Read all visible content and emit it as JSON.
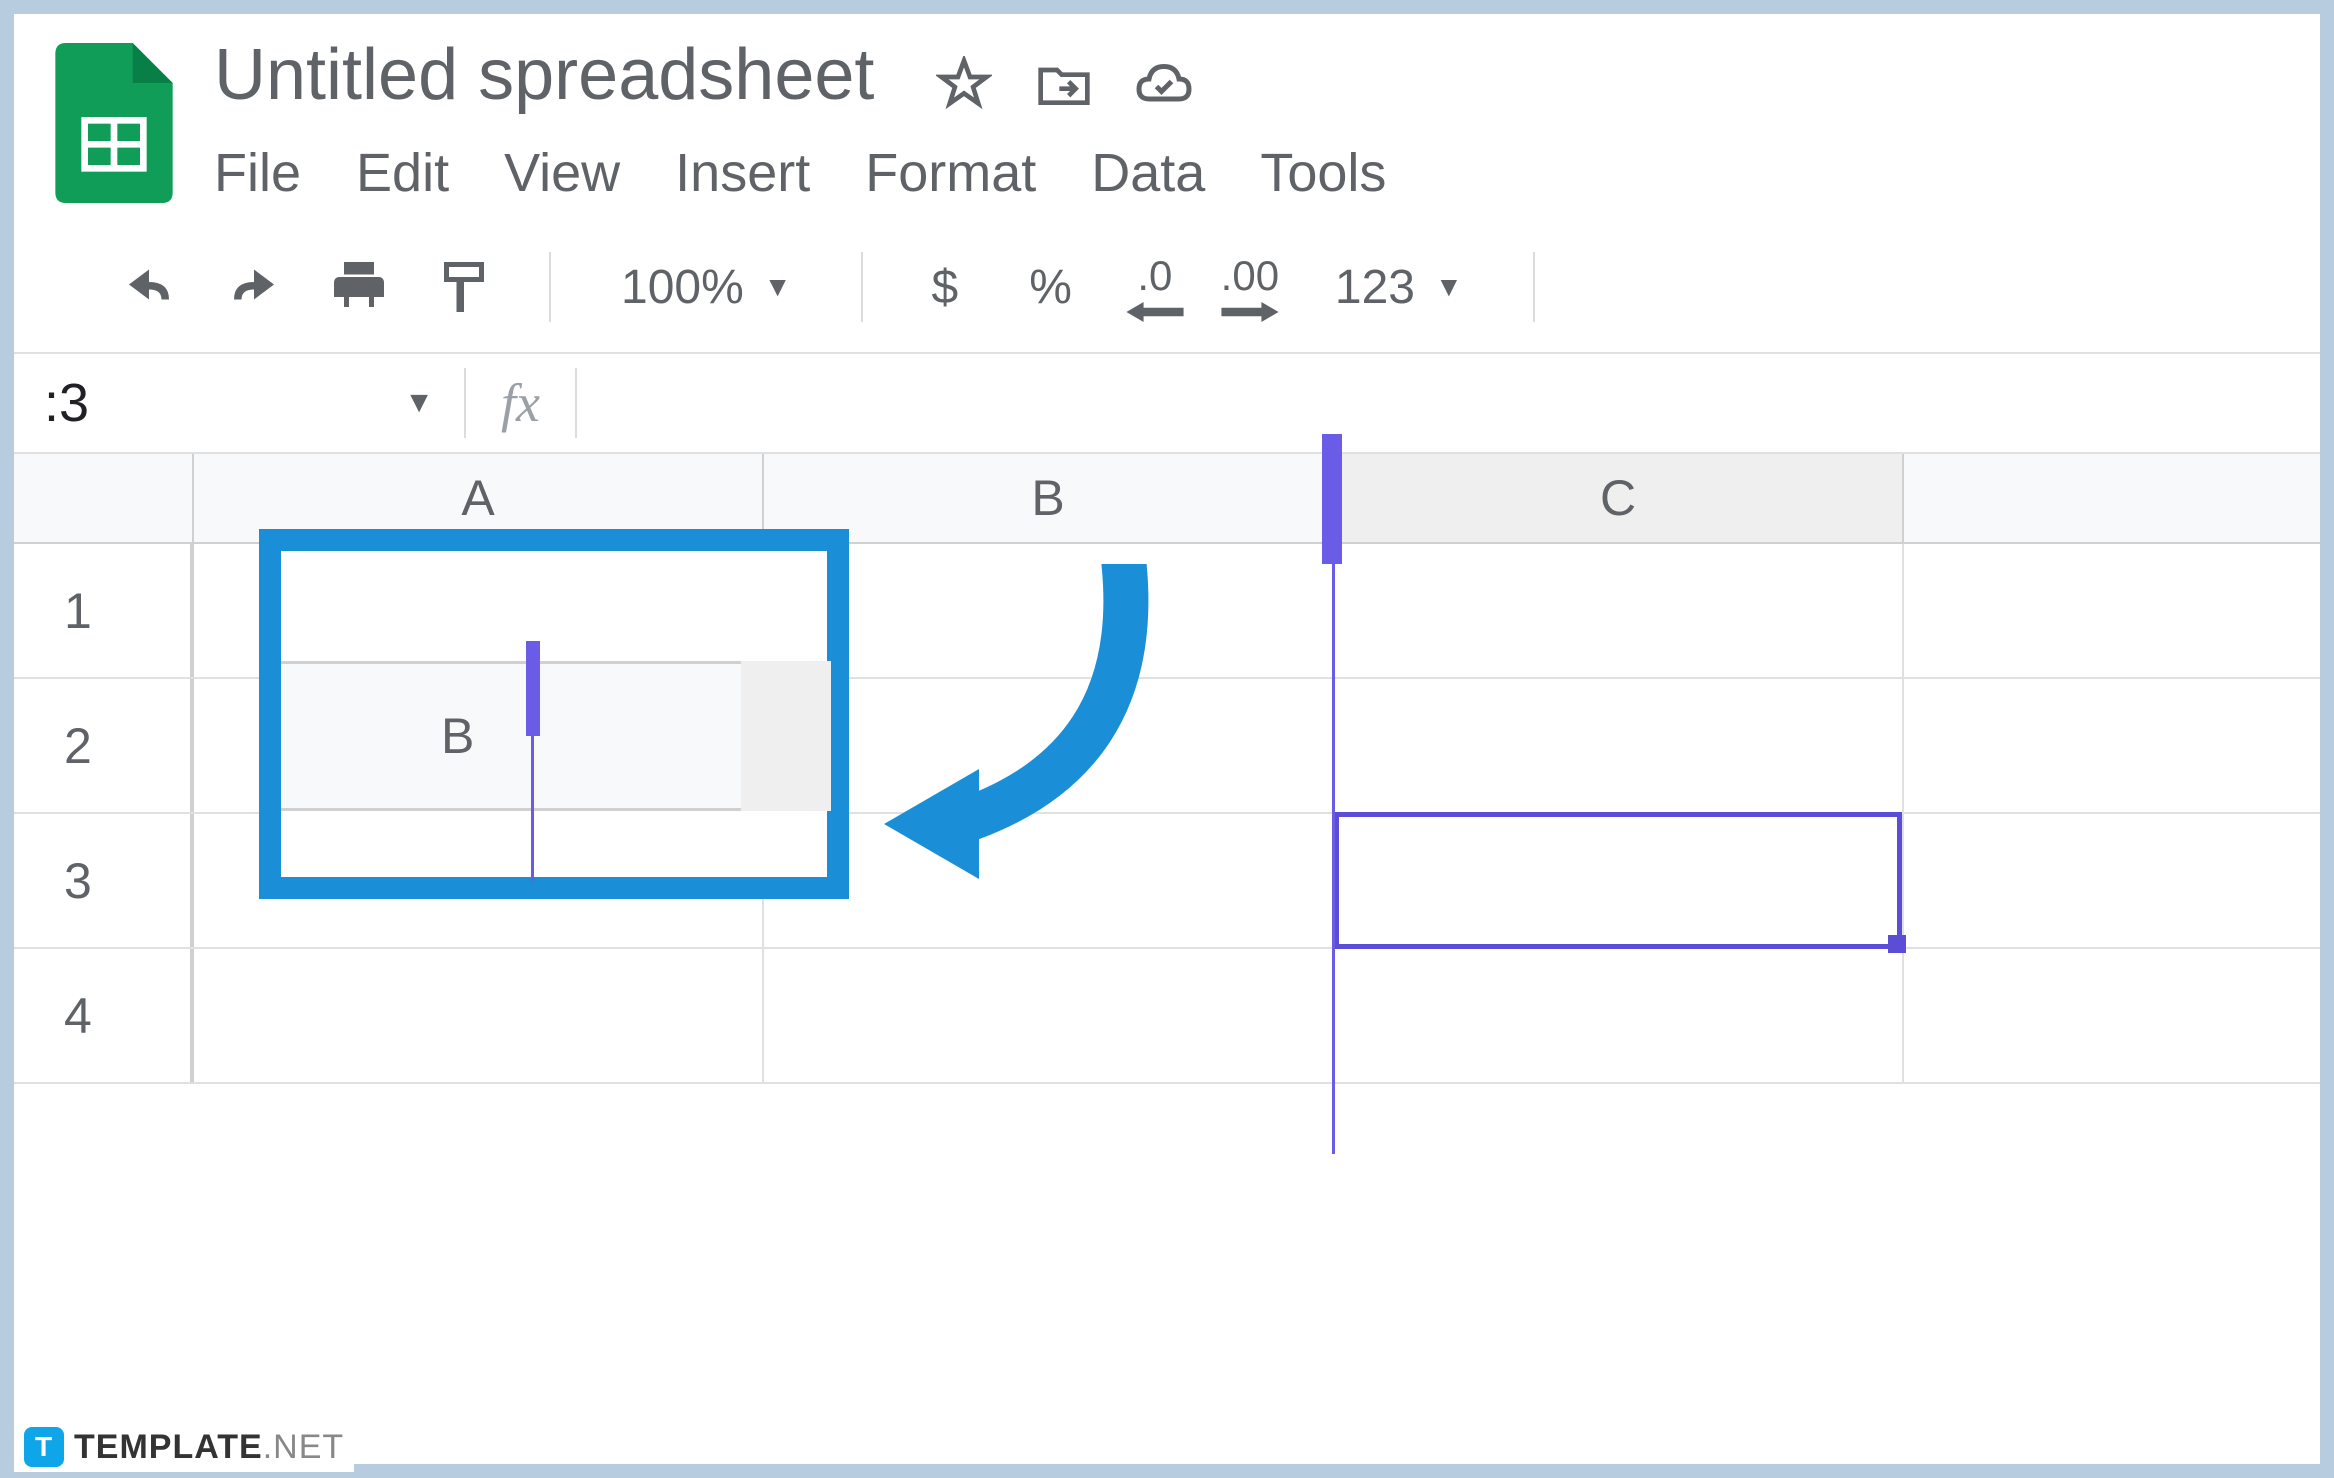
{
  "title": "Untitled spreadsheet",
  "menu": {
    "file": "File",
    "edit": "Edit",
    "view": "View",
    "insert": "Insert",
    "format": "Format",
    "data": "Data",
    "tools": "Tools"
  },
  "toolbar": {
    "zoom": "100%",
    "currency": "$",
    "percent": "%",
    "decrease_decimal": ".0",
    "increase_decimal": ".00",
    "format_num": "123"
  },
  "formula_bar": {
    "name_box": ":3",
    "fx": "fx"
  },
  "columns": {
    "a": "A",
    "b": "B",
    "c": "C"
  },
  "rows": {
    "r1": "1",
    "r2": "2",
    "r3": "3",
    "r4": "4"
  },
  "callout": {
    "col": "B"
  },
  "watermark": {
    "brand": "TEMPLATE",
    "suffix": ".NET"
  }
}
